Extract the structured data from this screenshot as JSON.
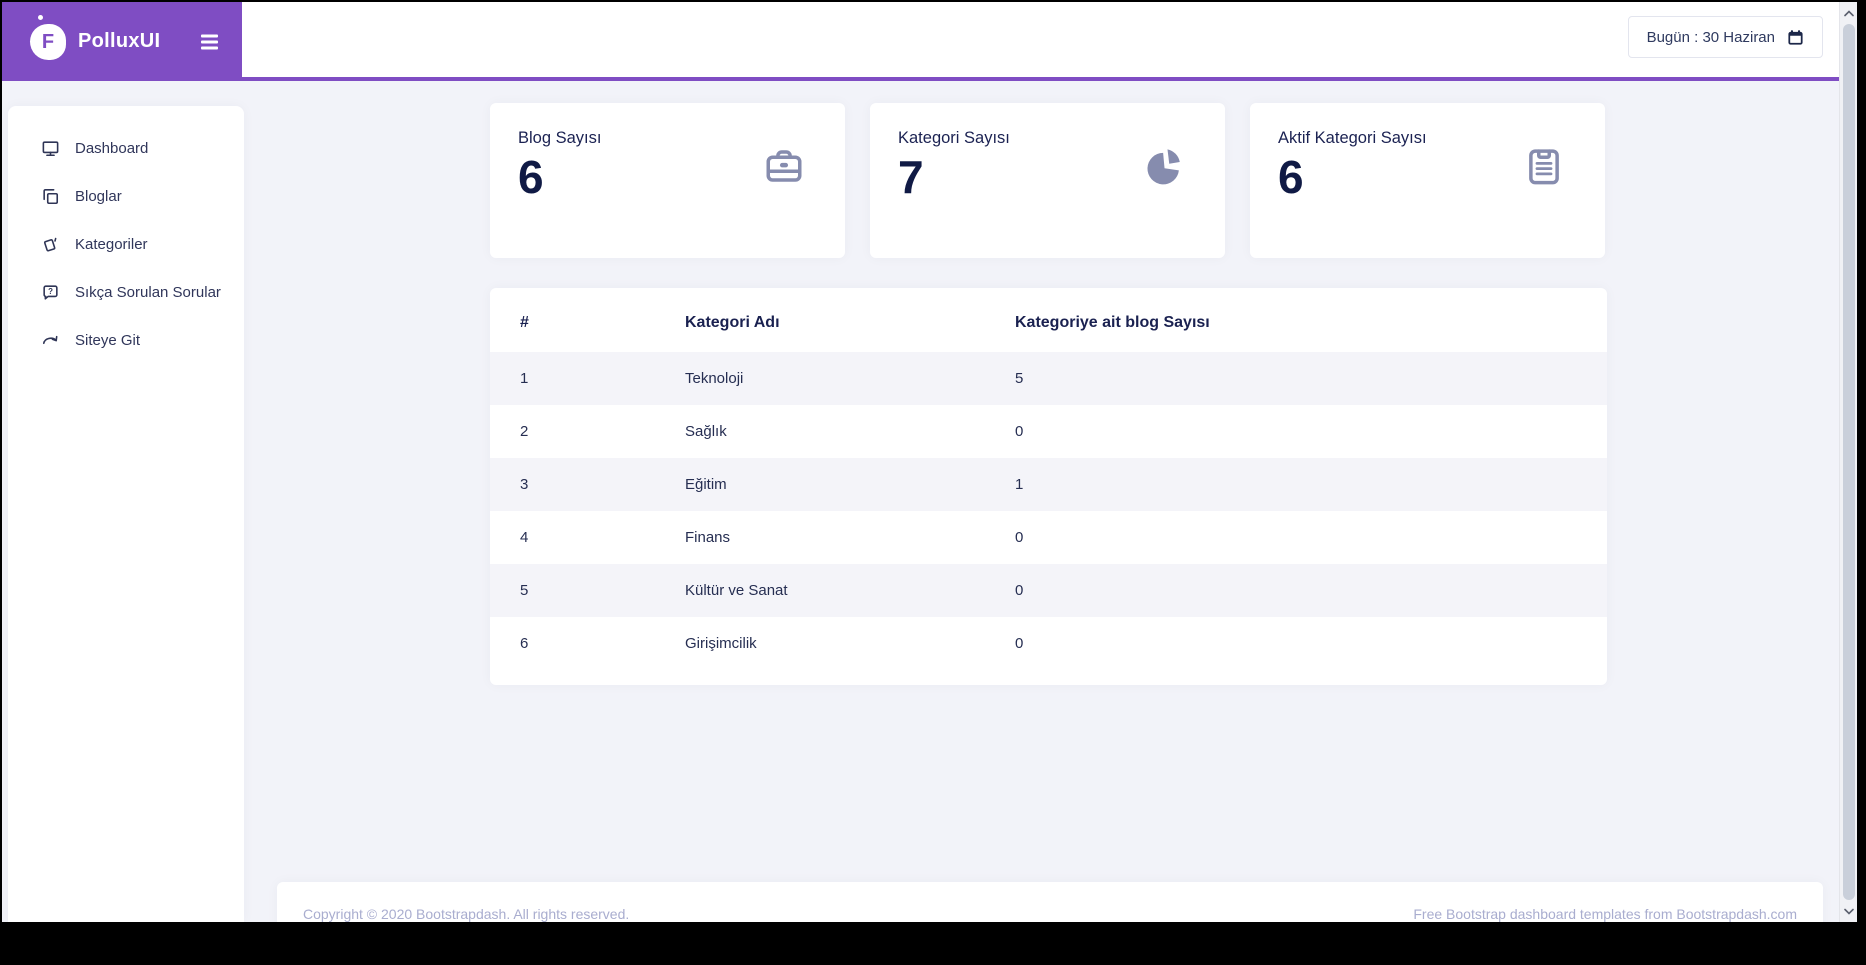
{
  "brand": {
    "name": "PolluxUI",
    "logo_letter": "F"
  },
  "navbar": {
    "date_button_label": "Bugün : 30 Haziran"
  },
  "sidebar": {
    "items": [
      {
        "label": "Dashboard",
        "icon": "monitor-icon"
      },
      {
        "label": "Bloglar",
        "icon": "copy-icon"
      },
      {
        "label": "Kategoriler",
        "icon": "tag-icon"
      },
      {
        "label": "Sıkça Sorulan Sorular",
        "icon": "question-bubble-icon"
      },
      {
        "label": "Siteye Git",
        "icon": "redo-arrow-icon"
      }
    ]
  },
  "stats": [
    {
      "label": "Blog Sayısı",
      "value": "6",
      "icon": "briefcase-icon"
    },
    {
      "label": "Kategori Sayısı",
      "value": "7",
      "icon": "pie-chart-icon"
    },
    {
      "label": "Aktif Kategori Sayısı",
      "value": "6",
      "icon": "clipboard-icon"
    }
  ],
  "table": {
    "headers": [
      "#",
      "Kategori Adı",
      "Kategoriye ait blog Sayısı"
    ],
    "rows": [
      [
        "1",
        "Teknoloji",
        "5"
      ],
      [
        "2",
        "Sağlık",
        "0"
      ],
      [
        "3",
        "Eğitim",
        "1"
      ],
      [
        "4",
        "Finans",
        "0"
      ],
      [
        "5",
        "Kültür ve Sanat",
        "0"
      ],
      [
        "6",
        "Girişimcilik",
        "0"
      ]
    ]
  },
  "footer": {
    "left": "Copyright © 2020 Bootstrapdash. All rights reserved.",
    "right": "Free Bootstrap dashboard templates from Bootstrapdash.com"
  },
  "colors": {
    "primary_purple": "#7f4dc3",
    "background": "#f2f3f9",
    "dark_navy": "#121a45",
    "muted_icon": "#868cae",
    "footer_text": "#a9adcf"
  }
}
